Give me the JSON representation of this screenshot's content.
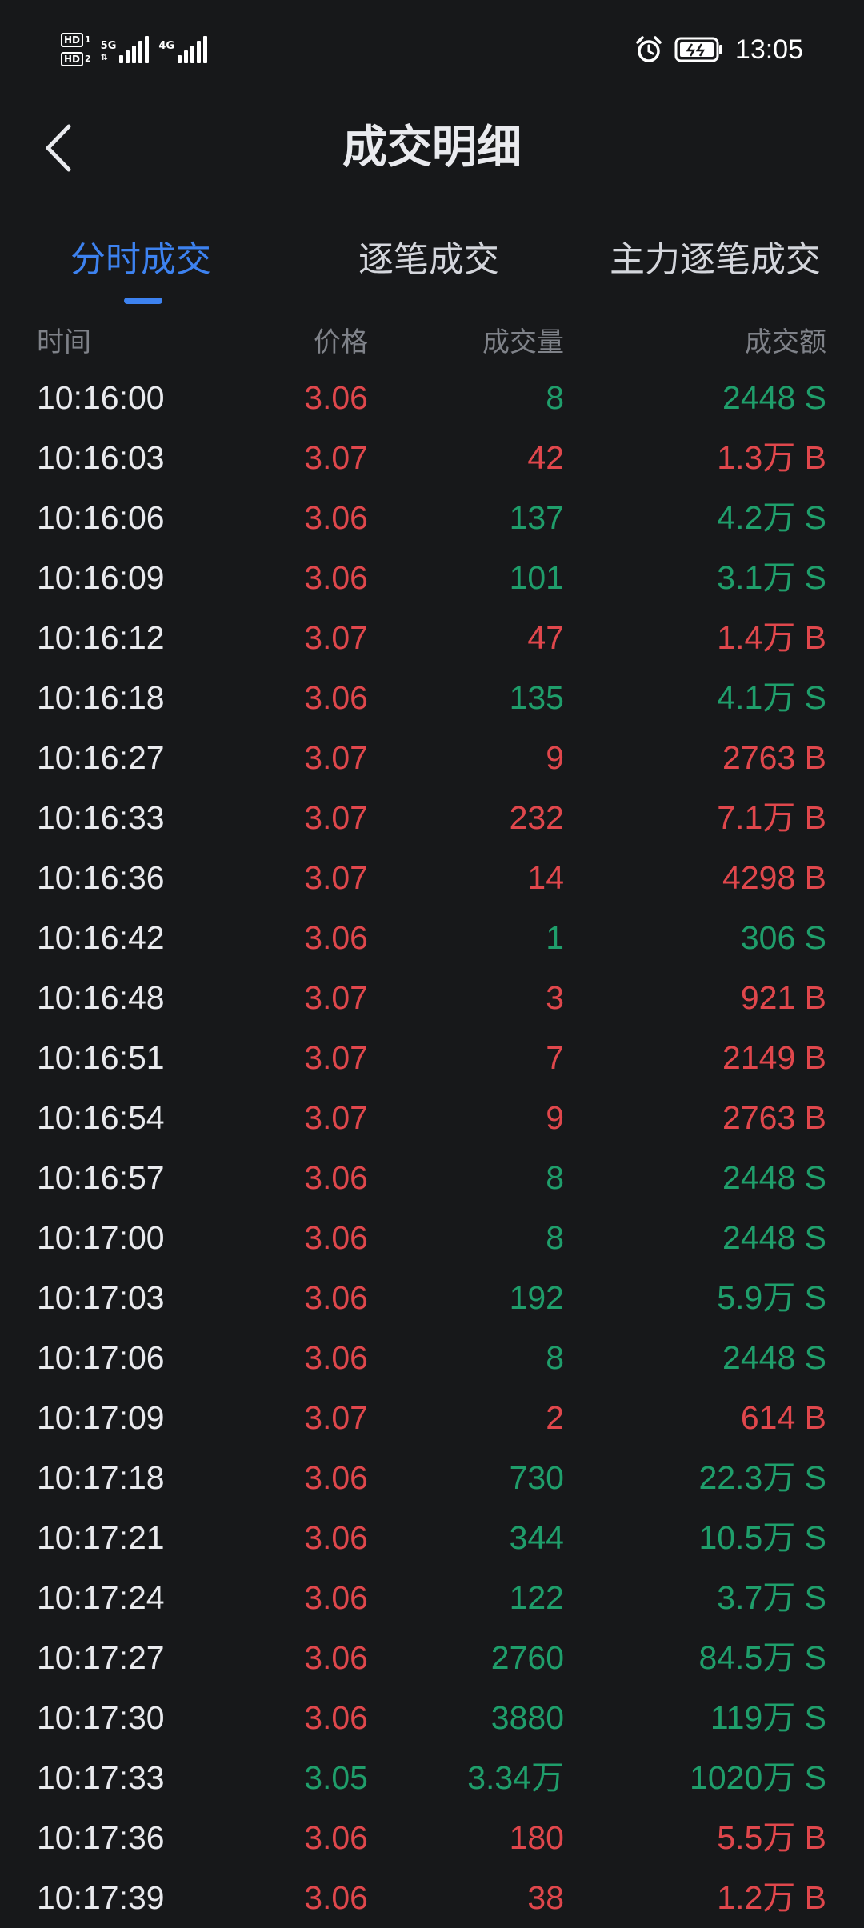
{
  "status_bar": {
    "time": "13:05",
    "hd1": "HD",
    "hd1_sim": "1",
    "hd2": "HD",
    "hd2_sim": "2",
    "net1": "5G",
    "net2": "4G"
  },
  "header": {
    "title": "成交明细"
  },
  "tabs": [
    {
      "label": "分时成交",
      "active": true
    },
    {
      "label": "逐笔成交",
      "active": false
    },
    {
      "label": "主力逐笔成交",
      "active": false
    }
  ],
  "columns": {
    "time": "时间",
    "price": "价格",
    "volume": "成交量",
    "amount": "成交额"
  },
  "colors": {
    "up": "#e0474c",
    "down": "#1f9e6b",
    "accent": "#3d82f0",
    "background": "#17181a"
  },
  "rows": [
    {
      "time": "10:16:00",
      "price": "3.06",
      "volume": "8",
      "amount": "2448 S",
      "dir": "S"
    },
    {
      "time": "10:16:03",
      "price": "3.07",
      "volume": "42",
      "amount": "1.3万 B",
      "dir": "B"
    },
    {
      "time": "10:16:06",
      "price": "3.06",
      "volume": "137",
      "amount": "4.2万 S",
      "dir": "S"
    },
    {
      "time": "10:16:09",
      "price": "3.06",
      "volume": "101",
      "amount": "3.1万 S",
      "dir": "S"
    },
    {
      "time": "10:16:12",
      "price": "3.07",
      "volume": "47",
      "amount": "1.4万 B",
      "dir": "B"
    },
    {
      "time": "10:16:18",
      "price": "3.06",
      "volume": "135",
      "amount": "4.1万 S",
      "dir": "S"
    },
    {
      "time": "10:16:27",
      "price": "3.07",
      "volume": "9",
      "amount": "2763 B",
      "dir": "B"
    },
    {
      "time": "10:16:33",
      "price": "3.07",
      "volume": "232",
      "amount": "7.1万 B",
      "dir": "B"
    },
    {
      "time": "10:16:36",
      "price": "3.07",
      "volume": "14",
      "amount": "4298 B",
      "dir": "B"
    },
    {
      "time": "10:16:42",
      "price": "3.06",
      "volume": "1",
      "amount": "306 S",
      "dir": "S"
    },
    {
      "time": "10:16:48",
      "price": "3.07",
      "volume": "3",
      "amount": "921 B",
      "dir": "B"
    },
    {
      "time": "10:16:51",
      "price": "3.07",
      "volume": "7",
      "amount": "2149 B",
      "dir": "B"
    },
    {
      "time": "10:16:54",
      "price": "3.07",
      "volume": "9",
      "amount": "2763 B",
      "dir": "B"
    },
    {
      "time": "10:16:57",
      "price": "3.06",
      "volume": "8",
      "amount": "2448 S",
      "dir": "S"
    },
    {
      "time": "10:17:00",
      "price": "3.06",
      "volume": "8",
      "amount": "2448 S",
      "dir": "S"
    },
    {
      "time": "10:17:03",
      "price": "3.06",
      "volume": "192",
      "amount": "5.9万 S",
      "dir": "S"
    },
    {
      "time": "10:17:06",
      "price": "3.06",
      "volume": "8",
      "amount": "2448 S",
      "dir": "S"
    },
    {
      "time": "10:17:09",
      "price": "3.07",
      "volume": "2",
      "amount": "614 B",
      "dir": "B"
    },
    {
      "time": "10:17:18",
      "price": "3.06",
      "volume": "730",
      "amount": "22.3万 S",
      "dir": "S"
    },
    {
      "time": "10:17:21",
      "price": "3.06",
      "volume": "344",
      "amount": "10.5万 S",
      "dir": "S"
    },
    {
      "time": "10:17:24",
      "price": "3.06",
      "volume": "122",
      "amount": "3.7万 S",
      "dir": "S"
    },
    {
      "time": "10:17:27",
      "price": "3.06",
      "volume": "2760",
      "amount": "84.5万 S",
      "dir": "S"
    },
    {
      "time": "10:17:30",
      "price": "3.06",
      "volume": "3880",
      "amount": "119万 S",
      "dir": "S"
    },
    {
      "time": "10:17:33",
      "price": "3.05",
      "volume": "3.34万",
      "amount": "1020万 S",
      "dir": "S"
    },
    {
      "time": "10:17:36",
      "price": "3.06",
      "volume": "180",
      "amount": "5.5万 B",
      "dir": "B"
    },
    {
      "time": "10:17:39",
      "price": "3.06",
      "volume": "38",
      "amount": "1.2万 B",
      "dir": "B"
    }
  ]
}
